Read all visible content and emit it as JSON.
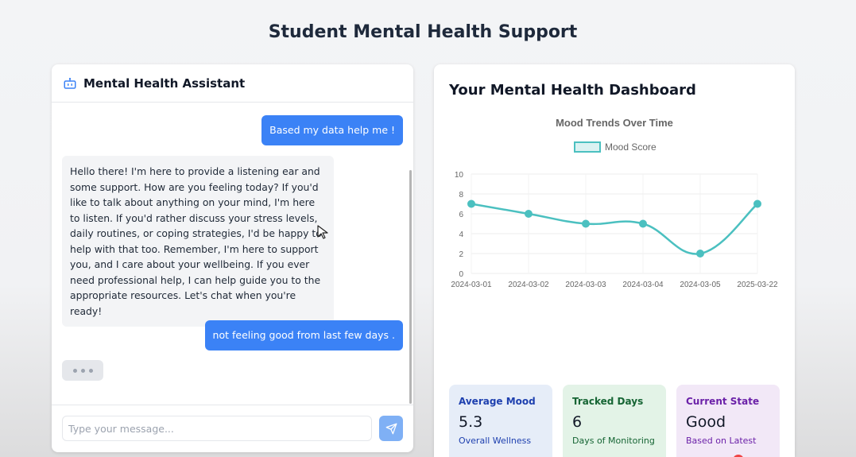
{
  "page": {
    "title": "Student Mental Health Support"
  },
  "chat": {
    "title": "Mental Health Assistant",
    "messages": [
      {
        "role": "user",
        "text": "Based my data help me !"
      },
      {
        "role": "assistant",
        "text": "Hello there! I'm here to provide a listening ear and some support. How are you feeling today? If you'd like to talk about anything on your mind, I'm here to listen. If you'd rather discuss your stress levels, daily routines, or coping strategies, I'd be happy to help with that too. Remember, I'm here to support you, and I care about your wellbeing. If you ever need professional help, I can help guide you to the appropriate resources. Let's chat when you're ready!"
      },
      {
        "role": "user",
        "text": "not feeling good from last few days ."
      }
    ],
    "input_placeholder": "Type your message...",
    "input_value": ""
  },
  "dashboard": {
    "title": "Your Mental Health Dashboard",
    "cards": [
      {
        "label": "Average Mood",
        "value": "5.3",
        "sub": "Overall Wellness"
      },
      {
        "label": "Tracked Days",
        "value": "6",
        "sub": "Days of Monitoring"
      },
      {
        "label": "Current State",
        "value": "Good",
        "sub": "Based on Latest"
      }
    ]
  },
  "chart_data": {
    "type": "line",
    "title": "Mood Trends Over Time",
    "series": [
      {
        "name": "Mood Score",
        "values": [
          7,
          6,
          5,
          5,
          2,
          7
        ],
        "color": "#4bc0c0"
      }
    ],
    "x": [
      "2024-03-01",
      "2024-03-02",
      "2024-03-03",
      "2024-03-04",
      "2024-03-05",
      "2025-03-22"
    ],
    "ylim": [
      0,
      10
    ],
    "yticks": [
      "0",
      "2",
      "4",
      "6",
      "8",
      "10"
    ],
    "grid": true,
    "legend": "top"
  },
  "colors": {
    "accent": "#3b82f6",
    "line": "#4bc0c0"
  }
}
